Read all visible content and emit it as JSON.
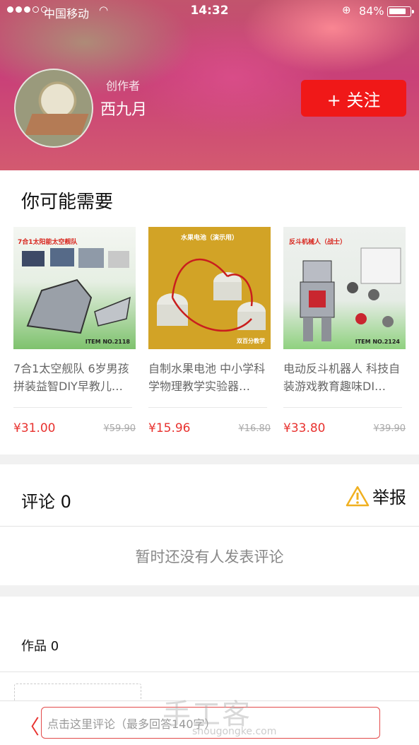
{
  "status_bar": {
    "carrier": "中国移动",
    "time": "14:32",
    "battery": "84%",
    "battery_level": 0.84
  },
  "profile": {
    "role": "创作者",
    "name": "西九月",
    "follow_label": "+ 关注"
  },
  "recommend": {
    "title": "你可能需要",
    "items": [
      {
        "name": "7合1太空舰队 6岁男孩拼装益智DIY早教儿…",
        "price": "¥31.00",
        "old_price": "¥59.90",
        "image_caption": "7合1太阳能太空舰队",
        "item_no": "ITEM NO.2118"
      },
      {
        "name": "自制水果电池 中小学科学物理教学实验器…",
        "price": "¥15.96",
        "old_price": "¥16.80",
        "image_caption": "水果电池（演示用）",
        "item_no": "双百分教学"
      },
      {
        "name": "电动反斗机器人 科技自装游戏教育趣味DI…",
        "price": "¥33.80",
        "old_price": "¥39.90",
        "image_caption": "反斗机械人（战士）",
        "item_no": "ITEM NO.2124"
      }
    ]
  },
  "comments": {
    "title": "评论 0",
    "report_label": "举报",
    "empty_text": "暂时还没有人发表评论"
  },
  "works": {
    "title": "作品 0"
  },
  "bottom_bar": {
    "input_placeholder": "点击这里评论（最多回答140字）"
  },
  "watermark": {
    "main": "手工客",
    "sub": "shougongke.com"
  },
  "colors": {
    "accent": "#f01818",
    "price": "#e8322f"
  }
}
